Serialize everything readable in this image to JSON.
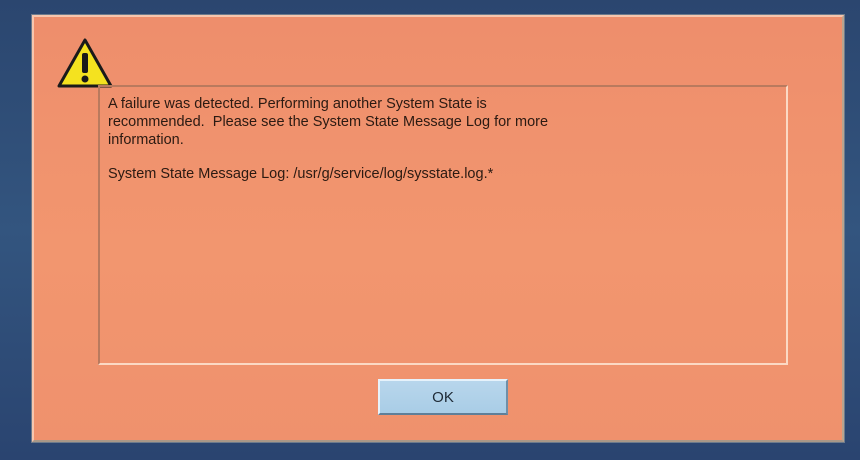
{
  "dialog": {
    "icon": "warning-triangle-icon",
    "message_lines": [
      "A failure was detected. Performing another System State is",
      "recommended.  Please see the System State Message Log for more",
      "information."
    ],
    "log_line": "System State Message Log: /usr/g/service/log/sysstate.log.*",
    "ok_label": "OK"
  },
  "colors": {
    "dialog_background": "#f2966f",
    "ok_button": "#a9cde6",
    "warning_icon_fill": "#f4e21f",
    "screen_background": "#2c4a78"
  }
}
